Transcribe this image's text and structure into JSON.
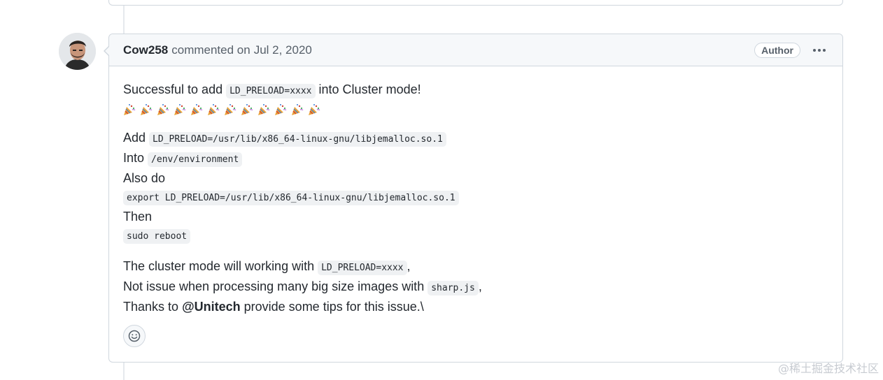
{
  "comment": {
    "author": "Cow258",
    "action": "commented on",
    "date": "Jul 2, 2020",
    "badge": "Author",
    "body": {
      "line1_prefix": "Successful to add",
      "line1_code": "LD_PRELOAD=xxxx",
      "line1_suffix": "into Cluster mode!",
      "emoji_count": 12,
      "add_label": "Add",
      "add_code": "LD_PRELOAD=/usr/lib/x86_64-linux-gnu/libjemalloc.so.1",
      "into_label": "Into",
      "into_code": "/env/environment",
      "also_do": "Also do",
      "export_code": "export LD_PRELOAD=/usr/lib/x86_64-linux-gnu/libjemalloc.so.1",
      "then_label": "Then",
      "reboot_code": "sudo reboot",
      "cluster_prefix": "The cluster mode will working with",
      "cluster_code": "LD_PRELOAD=xxxx",
      "cluster_suffix": ",",
      "issue_prefix": "Not issue when processing many big size images with",
      "issue_code": "sharp.js",
      "issue_suffix": ",",
      "thanks_prefix": "Thanks to",
      "thanks_mention": "@Unitech",
      "thanks_suffix": "provide some tips for this issue.\\"
    }
  },
  "watermark": "@稀土掘金技术社区",
  "icons": {
    "reaction": "smiley-icon",
    "menu": "kebab-horizontal-icon",
    "emoji": "party-popper-icon"
  }
}
